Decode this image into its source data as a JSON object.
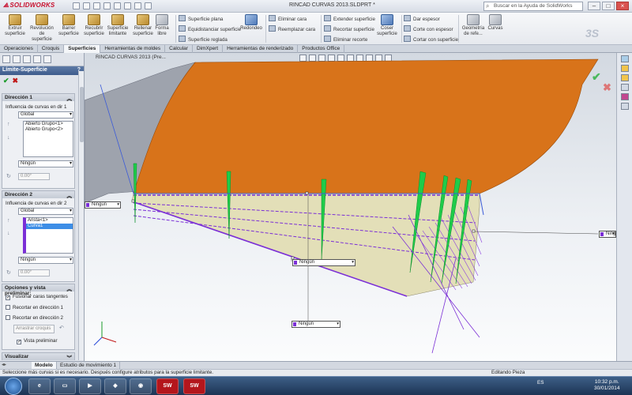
{
  "app": {
    "logo": "SOLIDWORKS",
    "doc_title": "RINCAD CURVAS 2013.SLDPRT *",
    "search_placeholder": "Buscar en la Ayuda de SolidWorks"
  },
  "ribbon": {
    "big_buttons": [
      "Extruir superficie",
      "Revolución de superficie",
      "Barrer superficie",
      "Recubrir superficie",
      "Superficie limitante",
      "Rellenar superficie",
      "Forma libre"
    ],
    "small_col1": [
      "Superficie plana",
      "Equidistanciar superficie",
      "Superficie reglada"
    ],
    "redondeo": "Redondeo",
    "small_col2": [
      "Eliminar cara",
      "Reemplazar cara"
    ],
    "small_col3": [
      "Extender superficie",
      "Recortar superficie",
      "Eliminar recorte"
    ],
    "coser": "Coser superficie",
    "small_col4": [
      "Dar espesor",
      "Corte con espesor",
      "Cortar con superficie"
    ],
    "geo_ref": "Geometría de refe...",
    "curvas": "Curvas"
  },
  "tabs": [
    "Operaciones",
    "Croquis",
    "Superficies",
    "Herramientas de moldes",
    "Calcular",
    "DimXpert",
    "Herramientas de renderizado",
    "Productos Office"
  ],
  "active_tab": "Superficies",
  "property_manager": {
    "title": "Límite-Superficie",
    "help": "?",
    "dir1": {
      "header": "Dirección 1",
      "influence_label": "Influencia de curvas en dir 1",
      "influence_value": "Global",
      "items": [
        "Abierto Grupo<1>",
        "Abierto Grupo<2>"
      ],
      "tangent": "Ningún",
      "angle": "0.00°"
    },
    "dir2": {
      "header": "Dirección 2",
      "influence_label": "Influencia de curvas en dir 2",
      "influence_value": "Global",
      "items": [
        "Arista<1>",
        "Curva1"
      ],
      "tangent": "Ningún",
      "angle": "0.00°"
    },
    "options": {
      "header": "Opciones y vista preliminar:",
      "merge": "Fusionar caras tangentes",
      "trim1": "Recortar en dirección 1",
      "trim2": "Recortar en dirección 2",
      "drag_btn": "Arrastrar croquis",
      "preview": "Vista preliminar"
    },
    "display_header": "Visualizar"
  },
  "viewport": {
    "hud_title": "RINCAD CURVAS 2013  (Pre...",
    "annotations": [
      "Ningún",
      "Ningún",
      "Ningún",
      "Ningún"
    ]
  },
  "bottom_tabs": [
    "Modelo",
    "Estudio de movimiento 1"
  ],
  "status": {
    "message": "Seleccione más curvas si es necesario. Después configure atributos para la superficie limitante.",
    "right": "Editando Pieza"
  },
  "taskbar": {
    "lang": "ES",
    "time": "10:32 p.m.",
    "date": "30/01/2014"
  },
  "colors": {
    "surface_top": "#d8731a",
    "surface_preview": "#e3dfb8",
    "curve_purple": "#7b2fd6",
    "connector_green": "#1fcc4a",
    "edge_blue": "#3b5bd8"
  }
}
